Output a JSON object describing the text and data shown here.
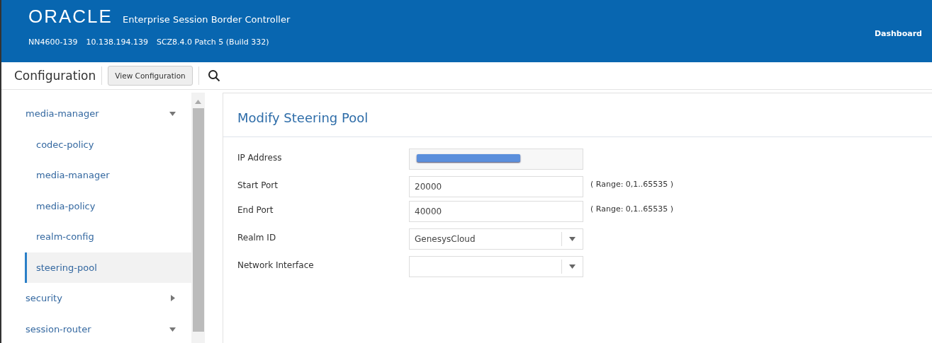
{
  "header": {
    "logo": "ORACLE",
    "product": "Enterprise Session Border Controller",
    "device": "NN4600-139",
    "ip": "10.138.194.139",
    "version": "SCZ8.4.0 Patch 5 (Build 332)",
    "dashboard": "Dashboard"
  },
  "toolbar": {
    "title": "Configuration",
    "view_button": "View Configuration"
  },
  "sidebar": {
    "items": [
      {
        "label": "media-manager",
        "expanded": true,
        "selected": false,
        "children": [
          {
            "label": "codec-policy",
            "selected": false
          },
          {
            "label": "media-manager",
            "selected": false
          },
          {
            "label": "media-policy",
            "selected": false
          },
          {
            "label": "realm-config",
            "selected": false
          },
          {
            "label": "steering-pool",
            "selected": true
          }
        ]
      },
      {
        "label": "security",
        "expanded": false,
        "selected": false
      },
      {
        "label": "session-router",
        "expanded": true,
        "selected": false
      }
    ]
  },
  "form": {
    "title": "Modify Steering Pool",
    "fields": [
      {
        "kind": "text",
        "label": "IP Address",
        "redacted": true
      },
      {
        "kind": "text",
        "label": "Start Port",
        "value": "20000",
        "hint": "( Range: 0,1..65535 )"
      },
      {
        "kind": "text",
        "label": "End Port",
        "value": "40000",
        "hint": "( Range: 0,1..65535 )"
      },
      {
        "kind": "select",
        "label": "Realm ID",
        "value": "GenesysCloud"
      },
      {
        "kind": "select",
        "label": "Network Interface"
      }
    ]
  }
}
